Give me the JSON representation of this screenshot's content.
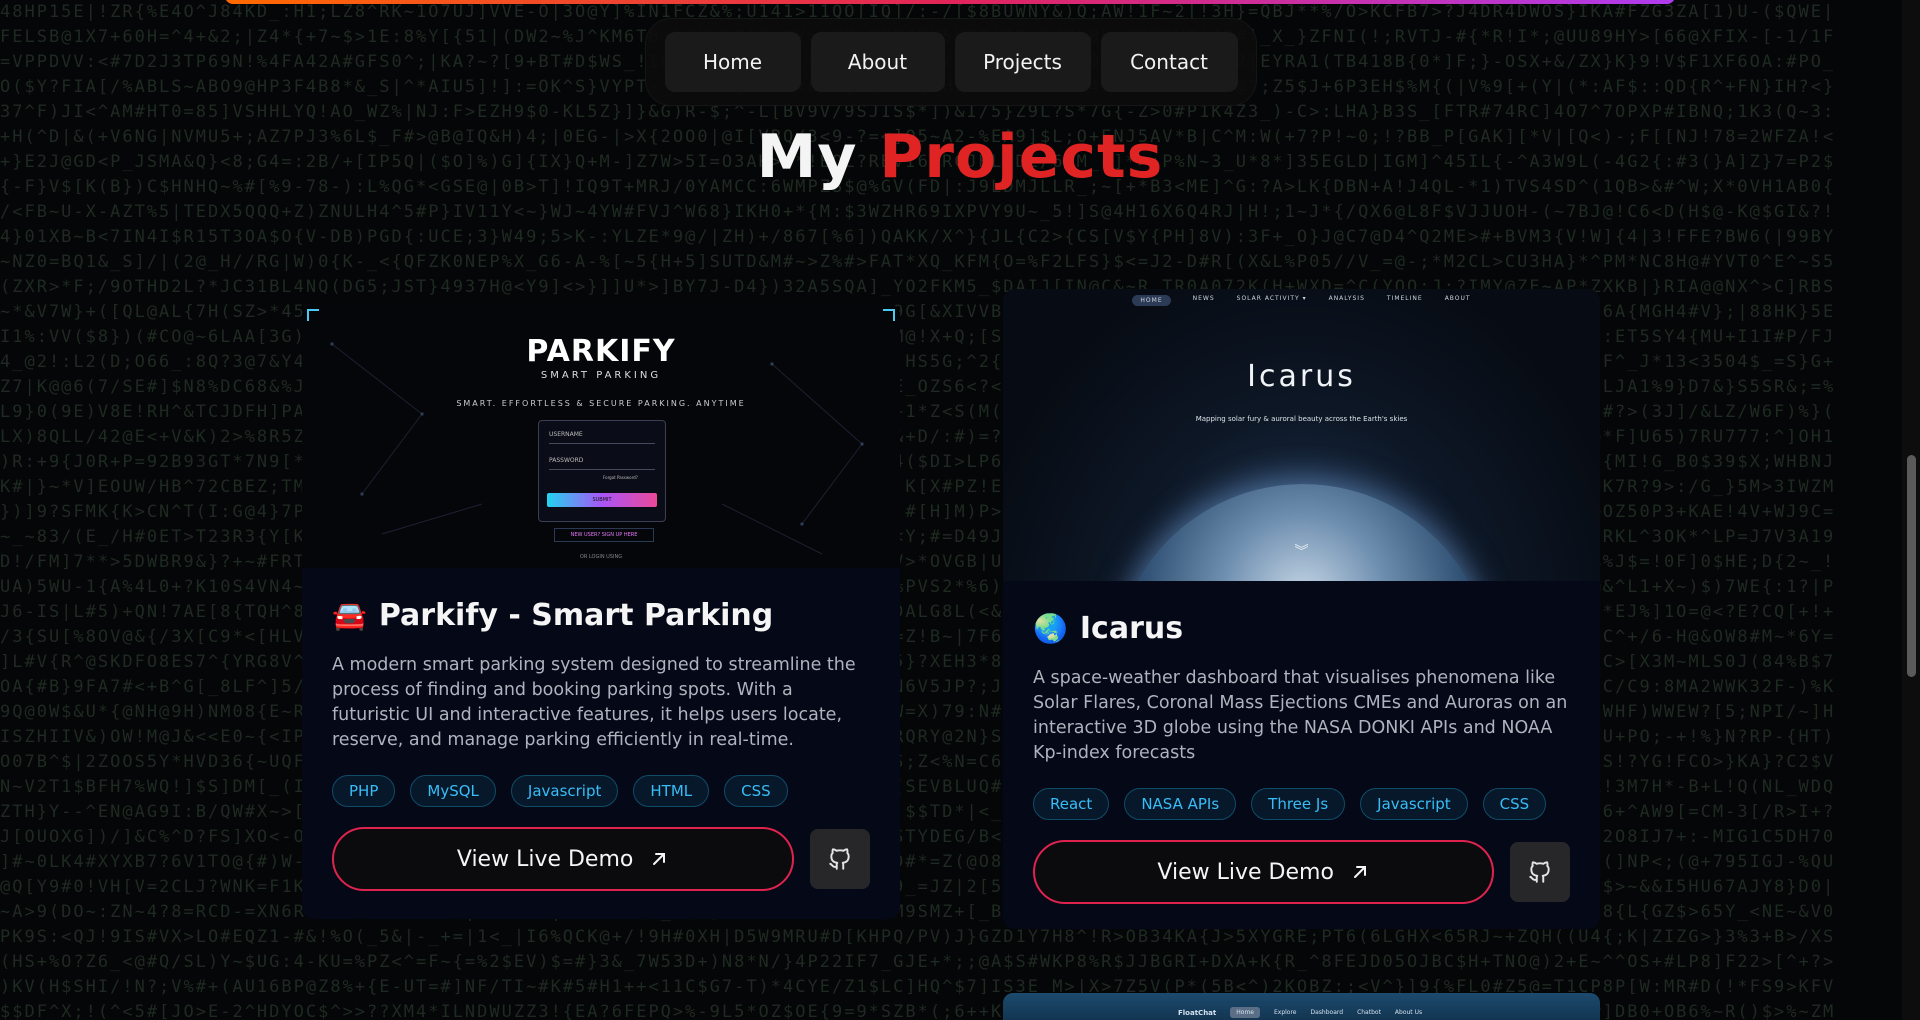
{
  "nav": {
    "items": [
      "Home",
      "About",
      "Projects",
      "Contact"
    ]
  },
  "section": {
    "title_white": "My",
    "title_red": "Projects"
  },
  "projects": [
    {
      "emoji": "🚘",
      "title": "Parkify - Smart Parking",
      "description": "A modern smart parking system designed to streamline the process of finding and booking parking spots. With a futuristic UI and interactive features, it helps users locate, reserve, and manage parking efficiently in real-time.",
      "tags": [
        "PHP",
        "MySQL",
        "Javascript",
        "HTML",
        "CSS"
      ],
      "demo_label": "View Live Demo",
      "preview": {
        "logo": "PARKIFY",
        "subtitle": "SMART PARKING",
        "tagline": "SMART. EFFORTLESS & SECURE PARKING. ANYTIME",
        "username_label": "USERNAME",
        "password_label": "PASSWORD",
        "forgot": "Forgot Password?",
        "submit": "SUBMIT",
        "signup": "NEW USER? SIGN UP HERE",
        "or_login": "OR LOGIN USING"
      }
    },
    {
      "emoji": "🌏",
      "title": "Icarus",
      "description": "A space-weather dashboard that visualises phenomena like Solar Flares, Coronal Mass Ejections CMEs and Auroras on an interactive 3D globe using the NASA DONKI APIs and NOAA Kp-index forecasts",
      "tags": [
        "React",
        "NASA APIs",
        "Three Js",
        "Javascript",
        "CSS"
      ],
      "demo_label": "View Live Demo",
      "preview": {
        "nav": [
          "HOME",
          "NEWS",
          "SOLAR ACTIVITY ▾",
          "ANALYSIS",
          "TIMELINE",
          "ABOUT"
        ],
        "title": "Icarus",
        "subtitle": "Mapping solar fury & auroral beauty across the Earth's skies"
      }
    }
  ],
  "next_preview": {
    "brand": "FloatChat",
    "nav": [
      "Home",
      "Explore",
      "Dashboard",
      "Chatbot",
      "About Us"
    ]
  },
  "colors": {
    "accent_red": "#e02424",
    "tag_text": "#38bdf8"
  }
}
